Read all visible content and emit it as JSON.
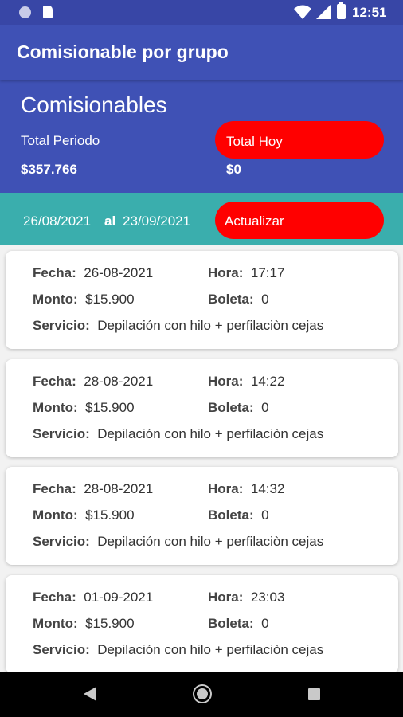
{
  "status_bar": {
    "time": "12:51",
    "icons": [
      "notification-dot-icon",
      "sd-card-icon",
      "wifi-icon",
      "cell-signal-icon",
      "battery-icon"
    ]
  },
  "app_bar": {
    "title": "Comisionable por grupo"
  },
  "summary": {
    "heading": "Comisionables",
    "period_label": "Total Periodo",
    "period_value": "$357.766",
    "today_button": "Total Hoy",
    "today_value": "$0"
  },
  "filter": {
    "date_from": "26/08/2021",
    "separator": "al",
    "date_to": "23/09/2021",
    "refresh_button": "Actualizar"
  },
  "labels": {
    "fecha": "Fecha:",
    "hora": "Hora:",
    "monto": "Monto:",
    "boleta": "Boleta:",
    "servicio": "Servicio:"
  },
  "records": [
    {
      "fecha": "26-08-2021",
      "hora": "17:17",
      "monto": "$15.900",
      "boleta": "0",
      "servicio": "Depilación con hilo  + perfilaciòn cejas"
    },
    {
      "fecha": "28-08-2021",
      "hora": "14:22",
      "monto": "$15.900",
      "boleta": "0",
      "servicio": "Depilación con hilo  + perfilaciòn cejas"
    },
    {
      "fecha": "28-08-2021",
      "hora": "14:32",
      "monto": "$15.900",
      "boleta": "0",
      "servicio": "Depilación con hilo  + perfilaciòn cejas"
    },
    {
      "fecha": "01-09-2021",
      "hora": "23:03",
      "monto": "$15.900",
      "boleta": "0",
      "servicio": "Depilación con hilo  + perfilaciòn cejas"
    }
  ],
  "colors": {
    "primary": "#3f51b5",
    "status_bar": "#3846a6",
    "accent_bar": "#3aaead",
    "button": "#ff0000"
  }
}
